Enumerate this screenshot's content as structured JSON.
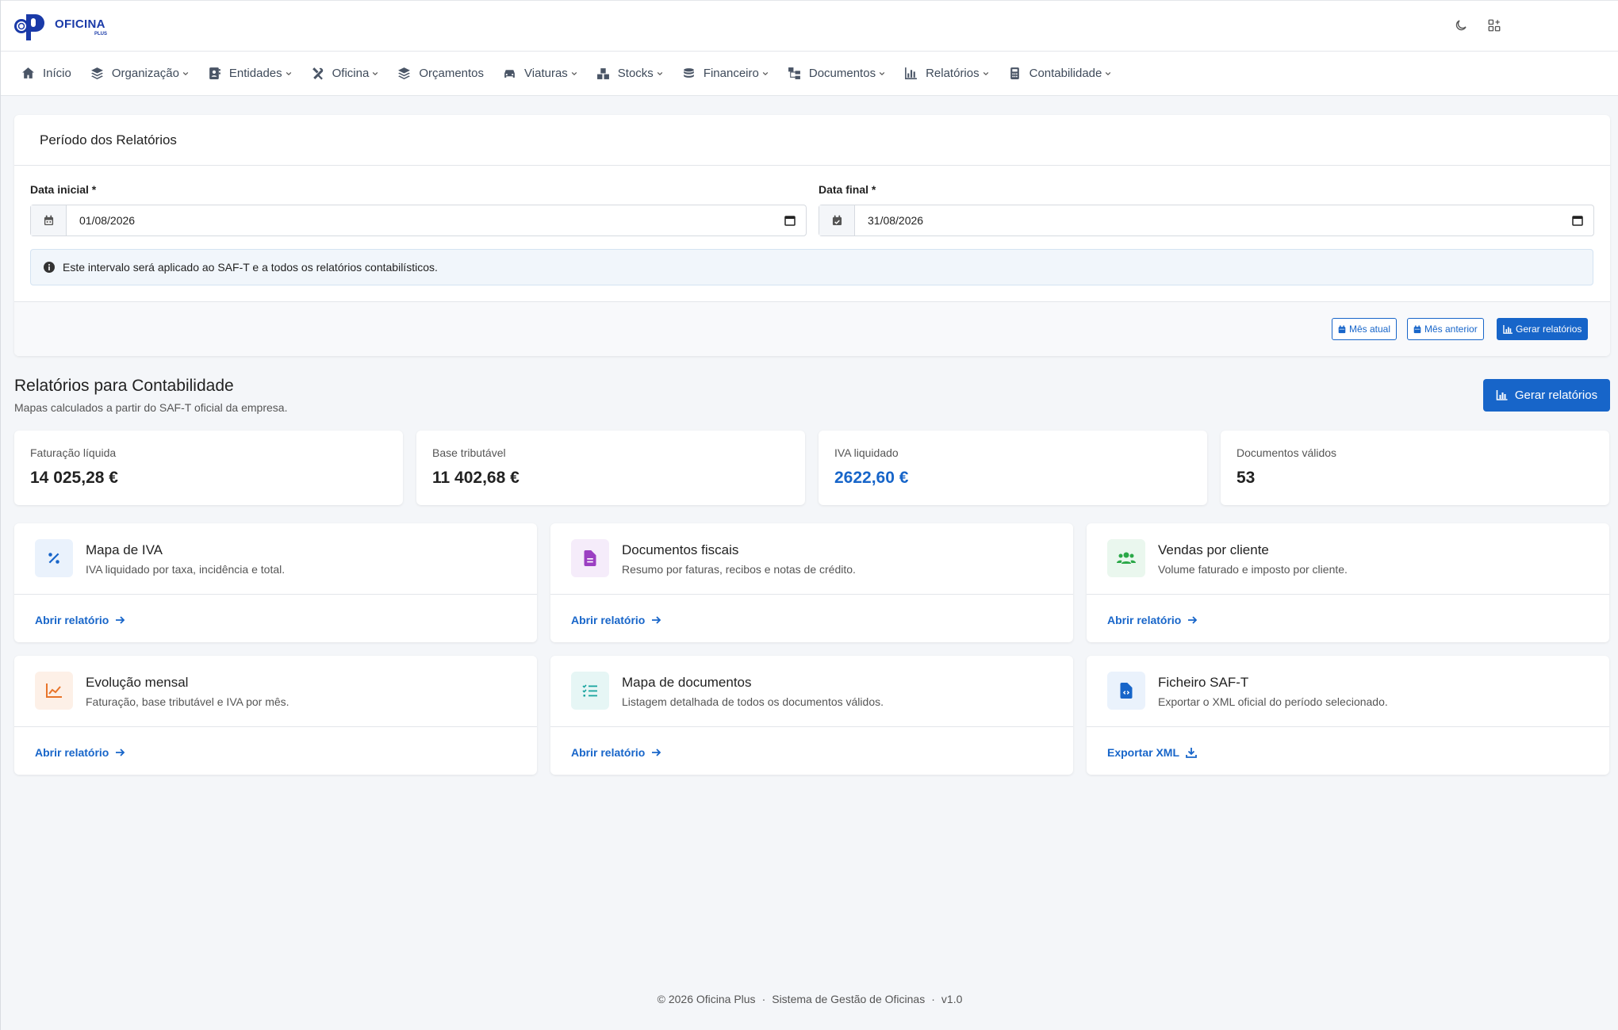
{
  "header": {
    "brand": "OFICINA",
    "brand_sub": "PLUS"
  },
  "nav": [
    {
      "label": "Início",
      "icon": "home-icon",
      "dropdown": false
    },
    {
      "label": "Organização",
      "icon": "layers-icon",
      "dropdown": true
    },
    {
      "label": "Entidades",
      "icon": "address-book-icon",
      "dropdown": true
    },
    {
      "label": "Oficina",
      "icon": "tools-icon",
      "dropdown": true
    },
    {
      "label": "Orçamentos",
      "icon": "layers-icon",
      "dropdown": false
    },
    {
      "label": "Viaturas",
      "icon": "car-icon",
      "dropdown": true
    },
    {
      "label": "Stocks",
      "icon": "boxes-icon",
      "dropdown": true
    },
    {
      "label": "Financeiro",
      "icon": "coins-icon",
      "dropdown": true
    },
    {
      "label": "Documentos",
      "icon": "sitemap-icon",
      "dropdown": true
    },
    {
      "label": "Relatórios",
      "icon": "chart-icon",
      "dropdown": true
    },
    {
      "label": "Contabilidade",
      "icon": "calculator-icon",
      "dropdown": true
    }
  ],
  "period": {
    "title": "Período dos Relatórios",
    "start_label": "Data inicial *",
    "start_value": "01/08/2026",
    "end_label": "Data final *",
    "end_value": "31/08/2026",
    "info": "Este intervalo será aplicado ao SAF-T e a todos os relatórios contabilísticos.",
    "btn_current": "Mês atual",
    "btn_previous": "Mês anterior",
    "btn_generate": "Gerar relatórios"
  },
  "section": {
    "title": "Relatórios para Contabilidade",
    "subtitle": "Mapas calculados a partir do SAF-T oficial da empresa.",
    "generate": "Gerar relatórios"
  },
  "stats": [
    {
      "label": "Faturação líquida",
      "value": "14 025,28 €"
    },
    {
      "label": "Base tributável",
      "value": "11 402,68 €"
    },
    {
      "label": "IVA liquidado",
      "value": "2622,60 €"
    },
    {
      "label": "Documentos válidos",
      "value": "53"
    }
  ],
  "reports": [
    {
      "title": "Mapa de IVA",
      "desc": "IVA liquidado por taxa, incidência e total.",
      "link": "Abrir relatório",
      "icon": "percent-icon",
      "color": "#1765c9",
      "bg": "#eaf2fc"
    },
    {
      "title": "Documentos fiscais",
      "desc": "Resumo por faturas, recibos e notas de crédito.",
      "link": "Abrir relatório",
      "icon": "file-icon",
      "color": "#9b3fc2",
      "bg": "#f5ecfa"
    },
    {
      "title": "Vendas por cliente",
      "desc": "Volume faturado e imposto por cliente.",
      "link": "Abrir relatório",
      "icon": "users-icon",
      "color": "#2ba848",
      "bg": "#eaf7ee"
    },
    {
      "title": "Evolução mensal",
      "desc": "Faturação, base tributável e IVA por mês.",
      "link": "Abrir relatório",
      "icon": "line-chart-icon",
      "color": "#e8742a",
      "bg": "#fdf0e7"
    },
    {
      "title": "Mapa de documentos",
      "desc": "Listagem detalhada de todos os documentos válidos.",
      "link": "Abrir relatório",
      "icon": "list-check-icon",
      "color": "#1aa5a0",
      "bg": "#e6f6f5"
    },
    {
      "title": "Ficheiro SAF-T",
      "desc": "Exportar o XML oficial do período selecionado.",
      "link": "Exportar XML",
      "icon": "file-code-icon",
      "color": "#1765c9",
      "bg": "#eaf2fc"
    }
  ],
  "footer": {
    "copy": "© 2026 Oficina Plus",
    "system": "Sistema de Gestão de Oficinas",
    "version": "v1.0"
  }
}
